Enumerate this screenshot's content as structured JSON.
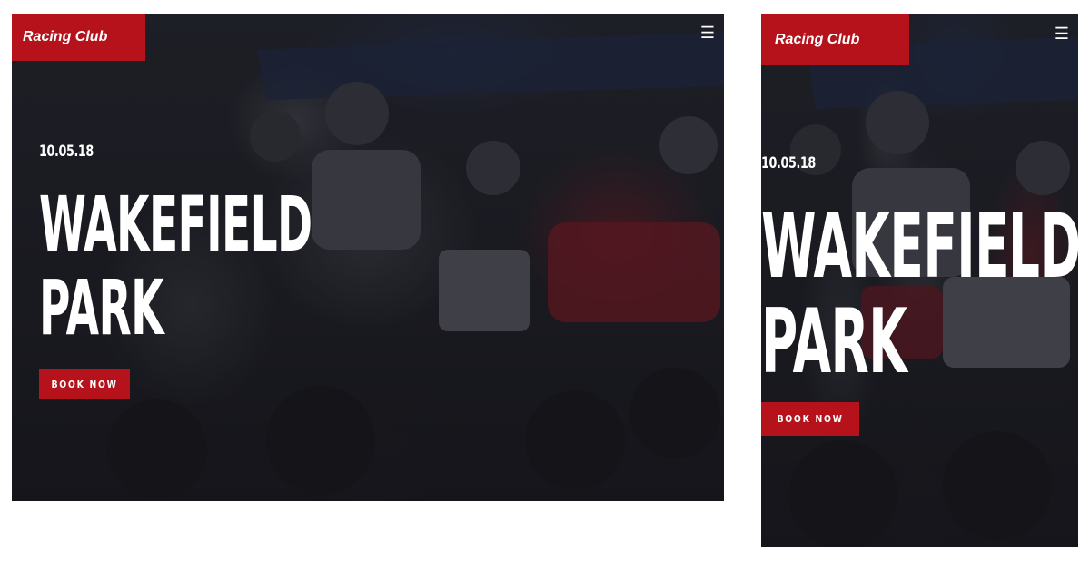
{
  "desktop": {
    "brand": "Racing Club",
    "menu_icon": "☰",
    "date": "10.05.18",
    "title_line1": "WAKEFIELD",
    "title_line2": "PARK",
    "cta": "BOOK NOW"
  },
  "mobile": {
    "brand": "Racing Club",
    "menu_icon": "☰",
    "date": "10.05.18",
    "title_line1": "WAKEFIELD",
    "title_line2": "PARK",
    "cta": "BOOK NOW"
  },
  "colors": {
    "accent": "#b5121b",
    "hero_overlay": "#24252b",
    "text": "#ffffff"
  },
  "icons": {
    "menu": "hamburger-menu-icon"
  }
}
